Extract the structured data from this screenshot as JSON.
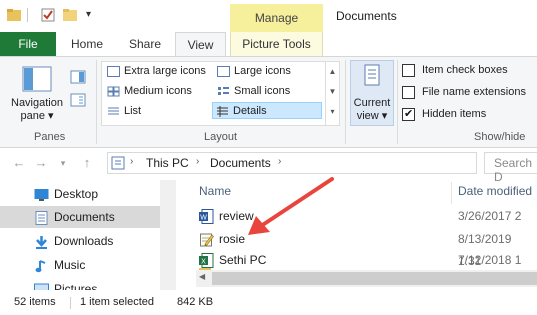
{
  "window": {
    "title": "Documents",
    "manage_label": "Manage"
  },
  "tabs": {
    "file": "File",
    "home": "Home",
    "share": "Share",
    "view": "View",
    "picture_tools": "Picture Tools"
  },
  "ribbon": {
    "panes": {
      "navigation_pane_line1": "Navigation",
      "navigation_pane_line2": "pane ▾",
      "group_label": "Panes"
    },
    "layout": {
      "items": {
        "extra_large_icons": "Extra large icons",
        "large_icons": "Large icons",
        "medium_icons": "Medium icons",
        "small_icons": "Small icons",
        "list": "List",
        "details": "Details"
      },
      "group_label": "Layout"
    },
    "current_view": {
      "line1": "Current",
      "line2": "view ▾"
    },
    "show_hide": {
      "item_check_boxes": "Item check boxes",
      "file_name_extensions": "File name extensions",
      "hidden_items": "Hidden items",
      "hidden_items_checked": true,
      "group_label": "Show/hide"
    }
  },
  "address": {
    "crumbs": [
      "This PC",
      "Documents"
    ],
    "search_placeholder": "Search D"
  },
  "nav_pane": {
    "items": [
      {
        "label": "Desktop",
        "icon": "desktop-icon"
      },
      {
        "label": "Documents",
        "icon": "documents-icon"
      },
      {
        "label": "Downloads",
        "icon": "downloads-icon"
      },
      {
        "label": "Music",
        "icon": "music-icon"
      },
      {
        "label": "Pictures",
        "icon": "pictures-icon"
      }
    ]
  },
  "file_list": {
    "columns": {
      "name": "Name",
      "date": "Date modified"
    },
    "rows": [
      {
        "name": "review",
        "date": "3/26/2017 2",
        "icon": "word-doc-icon"
      },
      {
        "name": "rosie",
        "date": "8/13/2019 1:31",
        "icon": "notepad-icon"
      },
      {
        "name": "Sethi PC",
        "date": "7/12/2018 1",
        "icon": "excel-icon"
      }
    ]
  },
  "status": {
    "items": "52 items",
    "selected": "1 item selected",
    "size": "842 KB"
  },
  "colors": {
    "file_tab": "#1f7a38",
    "manage_tab": "#f6f09c",
    "annotation_arrow": "#e8453c",
    "selection": "#cce8ff"
  }
}
